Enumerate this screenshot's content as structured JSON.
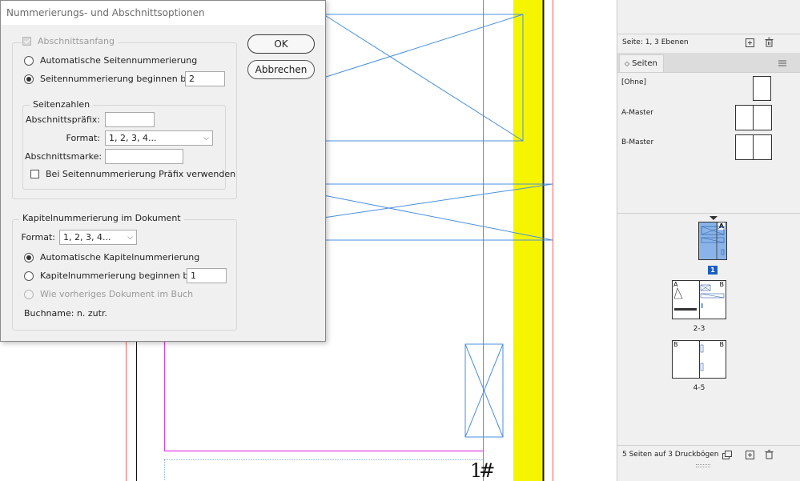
{
  "dialog": {
    "title": "Nummerierungs- und Abschnittsoptionen",
    "ok_label": "OK",
    "cancel_label": "Abbrechen",
    "section_start_label": "Abschnittsanfang",
    "auto_page_numbering_label": "Automatische Seitennummerierung",
    "start_page_numbering_label": "Seitennummerierung beginnen bei:",
    "start_page_value": "2",
    "page_numbers_group": {
      "legend": "Seitenzahlen",
      "prefix_label": "Abschnittspräfix:",
      "prefix_value": "",
      "format_label": "Format:",
      "format_value": "1, 2, 3, 4...",
      "marker_label": "Abschnittsmarke:",
      "marker_value": "",
      "include_prefix_label": "Bei Seitennummerierung Präfix verwenden"
    },
    "chapter_group": {
      "legend": "Kapitelnummerierung im Dokument",
      "format_label": "Format:",
      "format_value": "1, 2, 3, 4...",
      "auto_chapter_label": "Automatische Kapitelnummerierung",
      "start_chapter_label": "Kapitelnummerierung beginnen bei:",
      "start_chapter_value": "1",
      "same_as_previous_label": "Wie vorheriges Dokument im Buch",
      "book_name_label": "Buchname: n. zutr."
    }
  },
  "layers_panel": {
    "status": "Seite: 1, 3 Ebenen"
  },
  "pages_panel": {
    "tab_label": "Seiten",
    "masters": [
      {
        "label": "[Ohne]"
      },
      {
        "label": "A-Master"
      },
      {
        "label": "B-Master"
      }
    ],
    "spreads": [
      {
        "label": "1",
        "master_prefix": "A"
      },
      {
        "label": "2-3",
        "left_prefix": "A",
        "right_prefix": "B"
      },
      {
        "label": "4-5",
        "left_prefix": "B",
        "right_prefix": "B"
      }
    ],
    "status": "5 Seiten auf 3 Druckbögen"
  },
  "document": {
    "page_number_text": "1#"
  },
  "colors": {
    "frame_blue": "#4a8fe0",
    "margin_magenta": "#e040e0",
    "column_violet": "#8c6cf0",
    "bleed_red": "#ff5a5a",
    "yellow_bar": "#f5f500",
    "page_selected": "#8ab4e8"
  }
}
